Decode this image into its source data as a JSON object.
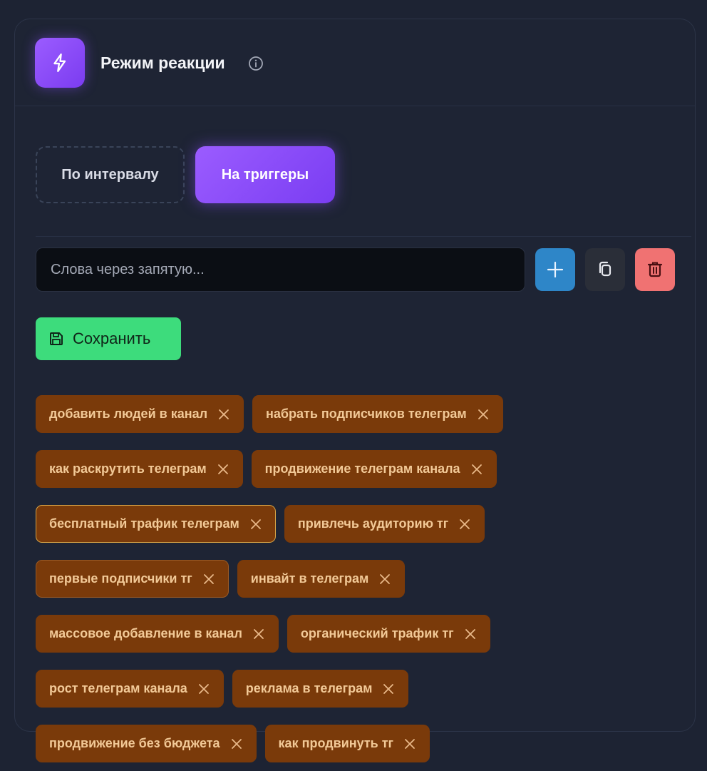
{
  "header": {
    "title": "Режим реакции",
    "icon": "lightning-icon",
    "accent": "#8b4cff"
  },
  "modes": {
    "interval_label": "По интервалу",
    "triggers_label": "На триггеры",
    "selected": "triggers"
  },
  "input": {
    "placeholder": "Слова через запятую...",
    "value": ""
  },
  "actions": {
    "add_icon": "plus-icon",
    "copy_icon": "copy-icon",
    "delete_icon": "trash-icon"
  },
  "save": {
    "label": "Сохранить",
    "icon": "floppy-disk-icon",
    "color": "#3ddc7c"
  },
  "tag_rows": [
    [
      "добавить людей в канал",
      "набрать подписчиков телеграм"
    ],
    [
      "как раскрутить телеграм",
      "продвижение телеграм канала"
    ],
    [
      "бесплатный трафик телеграм",
      "привлечь аудиторию тг"
    ],
    [
      "первые подписчики тг",
      "инвайт в телеграм"
    ],
    [
      "массовое добавление в канал",
      "органический трафик тг"
    ],
    [
      "рост телеграм канала",
      "реклама в телеграм"
    ],
    [
      "продвижение без бюджета",
      "как продвинуть тг"
    ]
  ],
  "tag_colors": {
    "background": "#7a3a0a",
    "text": "#f2c997"
  }
}
